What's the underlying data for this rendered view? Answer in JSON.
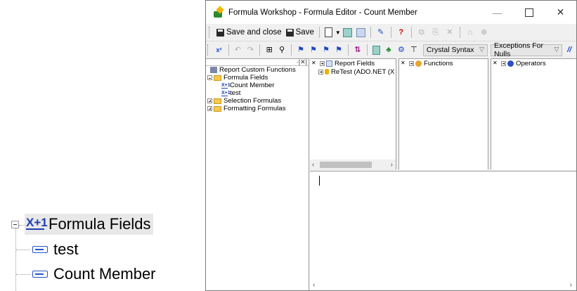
{
  "zoom_tree": {
    "folder_label": "Formula Fields",
    "items": [
      {
        "label": "test"
      },
      {
        "label": "Count Member"
      }
    ]
  },
  "window": {
    "title": "Formula Workshop - Formula Editor - Count Member",
    "controls": {
      "minimize": "—",
      "maximize": "",
      "close": "✕"
    }
  },
  "toolbar": {
    "save_close_label": "Save and close",
    "save_label": "Save"
  },
  "toolbar2": {
    "syntax_value": "Crystal Syntax",
    "nulls_value": "Exceptions For Nulls",
    "comment_label": "//"
  },
  "workshop_tree": {
    "custom_functions": "Report Custom Functions",
    "formula_fields": "Formula Fields",
    "formula_items": [
      {
        "label": "Count Member"
      },
      {
        "label": "test"
      }
    ],
    "selection_formulas": "Selection Formulas",
    "formatting_formulas": "Formatting Formulas"
  },
  "fields_pane": {
    "head": "Report Fields",
    "sub": "ReTest (ADO.NET (X"
  },
  "functions_pane": {
    "head": "Functions"
  },
  "operators_pane": {
    "head": "Operators"
  },
  "colors": {
    "accent_blue": "#1f3fb0",
    "folder_yellow": "#f3c94f",
    "window_bg": "#f0f0f0"
  }
}
